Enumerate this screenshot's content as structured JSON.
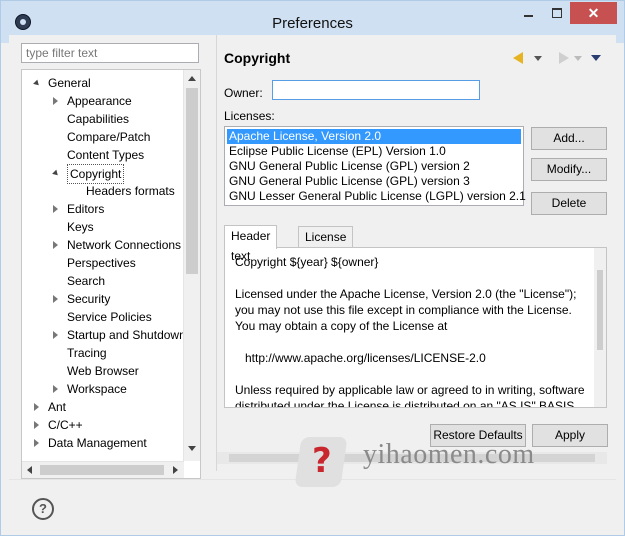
{
  "window": {
    "title": "Preferences"
  },
  "filter": {
    "placeholder": "type filter text"
  },
  "tree": [
    {
      "label": "General",
      "level": 0,
      "state": "expanded"
    },
    {
      "label": "Appearance",
      "level": 1,
      "state": "collapsed"
    },
    {
      "label": "Capabilities",
      "level": 1,
      "state": "leaf"
    },
    {
      "label": "Compare/Patch",
      "level": 1,
      "state": "leaf"
    },
    {
      "label": "Content Types",
      "level": 1,
      "state": "leaf"
    },
    {
      "label": "Copyright",
      "level": 1,
      "state": "expanded",
      "selected": true
    },
    {
      "label": "Headers formats",
      "level": 2,
      "state": "leaf"
    },
    {
      "label": "Editors",
      "level": 1,
      "state": "collapsed"
    },
    {
      "label": "Keys",
      "level": 1,
      "state": "leaf"
    },
    {
      "label": "Network Connections",
      "level": 1,
      "state": "collapsed"
    },
    {
      "label": "Perspectives",
      "level": 1,
      "state": "leaf"
    },
    {
      "label": "Search",
      "level": 1,
      "state": "leaf"
    },
    {
      "label": "Security",
      "level": 1,
      "state": "collapsed"
    },
    {
      "label": "Service Policies",
      "level": 1,
      "state": "leaf"
    },
    {
      "label": "Startup and Shutdown",
      "level": 1,
      "state": "collapsed"
    },
    {
      "label": "Tracing",
      "level": 1,
      "state": "leaf"
    },
    {
      "label": "Web Browser",
      "level": 1,
      "state": "leaf"
    },
    {
      "label": "Workspace",
      "level": 1,
      "state": "collapsed"
    },
    {
      "label": "Ant",
      "level": 0,
      "state": "collapsed"
    },
    {
      "label": "C/C++",
      "level": 0,
      "state": "collapsed"
    },
    {
      "label": "Data Management",
      "level": 0,
      "state": "collapsed"
    }
  ],
  "page": {
    "title": "Copyright",
    "owner_label": "Owner:",
    "owner_value": "",
    "licenses_label": "Licenses:",
    "licenses": [
      {
        "label": "Apache License, Version 2.0",
        "selected": true
      },
      {
        "label": "Eclipse Public License (EPL) Version 1.0",
        "selected": false
      },
      {
        "label": "GNU General Public License (GPL) version 2",
        "selected": false
      },
      {
        "label": "GNU General Public License (GPL) version 3",
        "selected": false
      },
      {
        "label": "GNU Lesser General Public License (LGPL) version 2.1",
        "selected": false
      }
    ],
    "buttons": {
      "add": "Add...",
      "modify": "Modify...",
      "delete": "Delete"
    },
    "tabs": [
      "Header text",
      "License file"
    ],
    "header_text": "Copyright ${year} ${owner}\n\nLicensed under the Apache License, Version 2.0 (the \"License\");\nyou may not use this file except in compliance with the License.\nYou may obtain a copy of the License at\n\n   http://www.apache.org/licenses/LICENSE-2.0\n\nUnless required by applicable law or agreed to in writing, software\ndistributed under the License is distributed on an \"AS IS\" BASIS,",
    "restore_defaults": "Restore Defaults",
    "apply": "Apply"
  },
  "watermark": {
    "text": "yihaomen.com"
  },
  "icons": {
    "back": "back-arrow-icon",
    "forward": "forward-arrow-icon",
    "view_menu": "view-menu-icon",
    "help": "help-icon"
  },
  "colors": {
    "selection": "#3399ff",
    "titlebar": "#cfe0f2",
    "close": "#c75050"
  }
}
